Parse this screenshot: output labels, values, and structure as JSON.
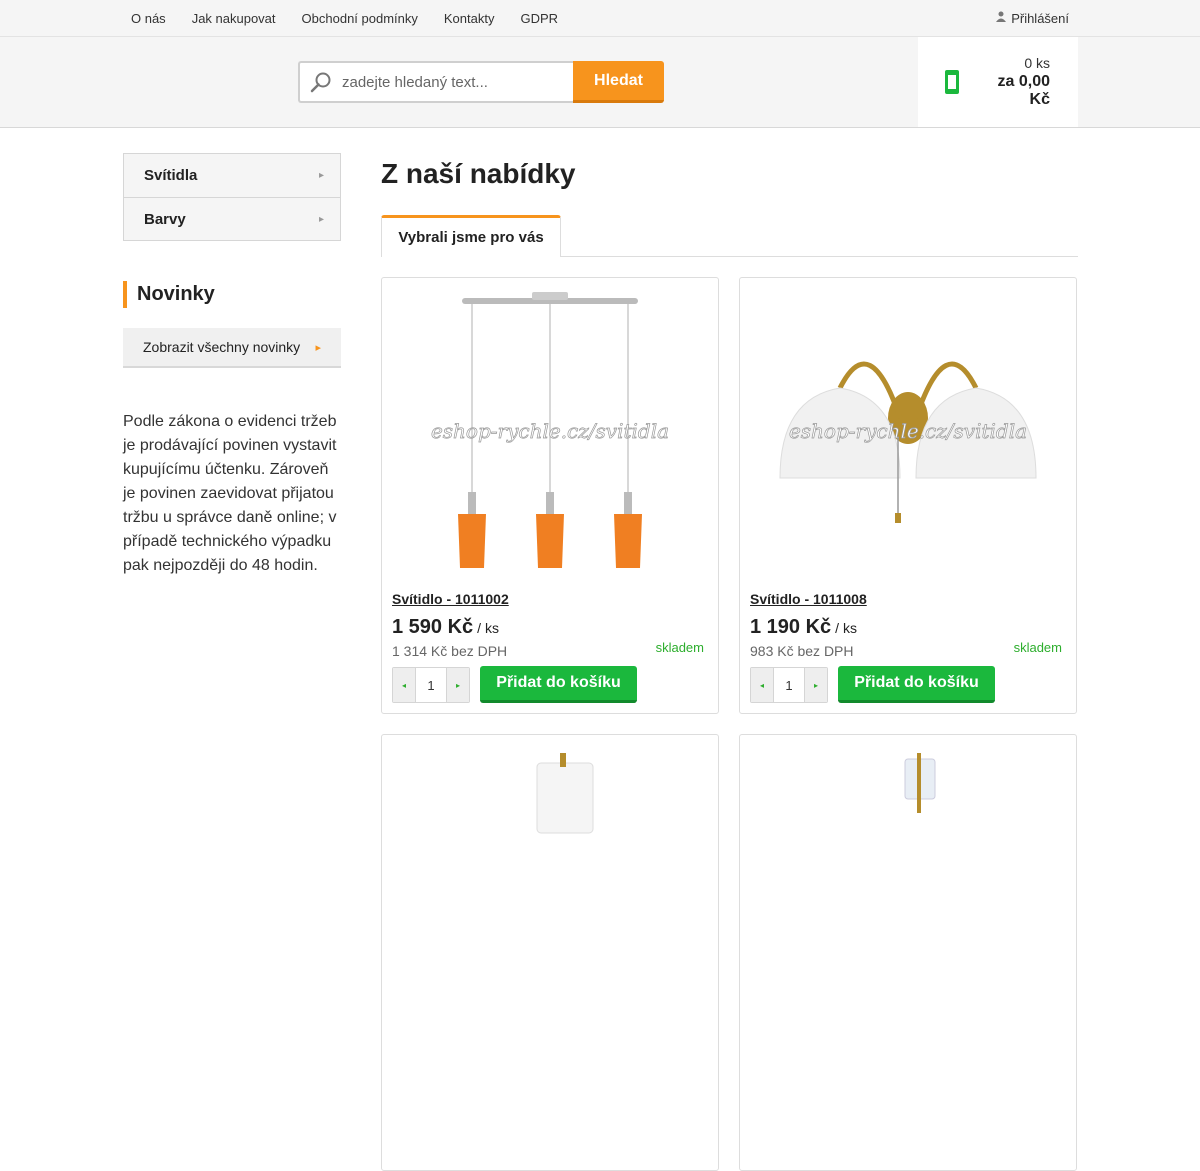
{
  "topnav": {
    "links": [
      "O nás",
      "Jak nakupovat",
      "Obchodní podmínky",
      "Kontakty",
      "GDPR"
    ],
    "login_label": "Přihlášení"
  },
  "search": {
    "placeholder": "zadejte hledaný text...",
    "button_label": "Hledat"
  },
  "cart": {
    "quantity": "0 ks",
    "total": "za 0,00 Kč"
  },
  "sidebar": {
    "categories": [
      "Svítidla",
      "Barvy"
    ],
    "news_heading": "Novinky",
    "news_button": "Zobrazit všechny novinky",
    "law_text": "Podle zákona o evidenci tržeb je prodávající povinen vystavit kupujícímu účtenku. Zároveň je povinen zaevidovat přijatou tržbu u správce daně online; v případě technického výpadku pak nejpozději do 48 hodin."
  },
  "main": {
    "title": "Z naší nabídky",
    "tab": "Vybrali jsme pro vás",
    "products": [
      {
        "name": "Svítidlo - 1011002",
        "price": "1 590 Kč",
        "unit": "/ ks",
        "net_price": "1 314 Kč bez DPH",
        "stock": "skladem",
        "qty": "1",
        "add_label": "Přidat do košíku",
        "watermark": "eshop-rychle.cz/svitidla"
      },
      {
        "name": "Svítidlo - 1011008",
        "price": "1 190 Kč",
        "unit": "/ ks",
        "net_price": "983 Kč bez DPH",
        "stock": "skladem",
        "qty": "1",
        "add_label": "Přidat do košíku",
        "watermark": "eshop-rychle.cz/svitidla"
      }
    ]
  },
  "colors": {
    "accent_orange": "#f7941d",
    "add_green": "#1bb83d",
    "stock_green": "#2dae2d"
  }
}
